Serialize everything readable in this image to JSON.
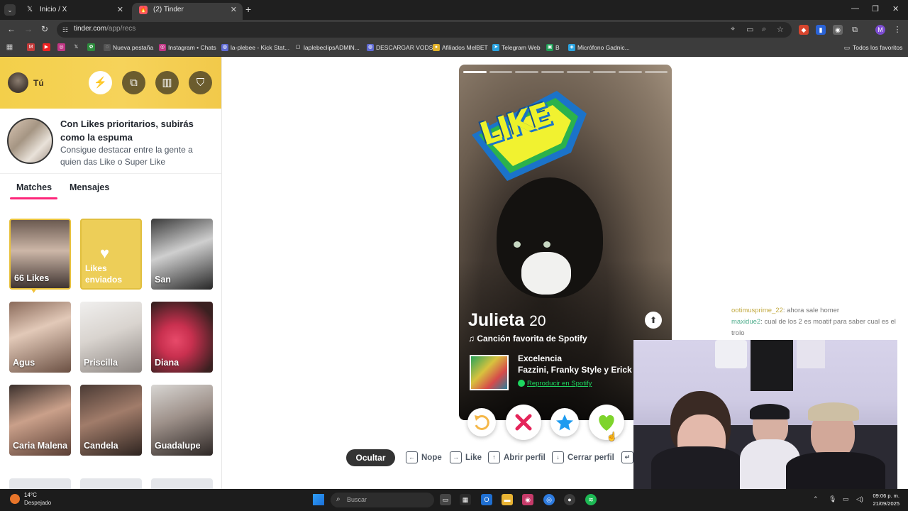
{
  "browser": {
    "tabs": [
      {
        "title": "Inicio / X",
        "icon": "x-logo"
      },
      {
        "title": "(2) Tinder",
        "icon": "tinder-logo"
      }
    ],
    "url_host": "tinder.com",
    "url_path": "/app/recs",
    "bookmarks": [
      "Nueva pestaña",
      "Instagram • Chats",
      "la-plebee - Kick Stat...",
      "laplebeclipsADMIN...",
      "DESCARGAR VODS",
      "Afiliados MelBET",
      "Telegram Web",
      "B",
      "Micrófono Gadnic..."
    ],
    "all_bookmarks": "Todos los favoritos",
    "profile_initial": "M"
  },
  "sidebar": {
    "me_label": "Tú",
    "header_buttons": [
      "boost-icon",
      "explore-icon",
      "briefcase-icon",
      "shield-icon"
    ],
    "promo_title": "Con Likes prioritarios, subirás como la espuma",
    "promo_sub": "Consigue destacar entre la gente a quien das Like o Super Like",
    "tabs": [
      "Matches",
      "Mensajes"
    ],
    "matches": [
      {
        "name": "66 Likes"
      },
      {
        "name": "Likes enviados"
      },
      {
        "name": "San"
      },
      {
        "name": "Agus"
      },
      {
        "name": "Priscilla"
      },
      {
        "name": "Diana"
      },
      {
        "name": "Caria Malena"
      },
      {
        "name": "Candela"
      },
      {
        "name": "Guadalupe"
      }
    ]
  },
  "card": {
    "sticker_text": "LIKE",
    "name": "Julieta",
    "age": "20",
    "spotify_header": "Canción favorita de Spotify",
    "song_title": "Excelencia",
    "song_artists": "Fazzini, Franky Style y Erick V",
    "play_label": "Reproducir en Spotify",
    "photo_count": 8,
    "active_photo": 0
  },
  "actions": [
    "rewind-icon",
    "nope-icon",
    "super-like-icon",
    "like-icon"
  ],
  "shortcuts": {
    "hide": "Ocultar",
    "nope": "Nope",
    "like": "Like",
    "open_profile": "Abrir perfil",
    "close_profile": "Cerrar perfil"
  },
  "chat": [
    {
      "user": "ootimusprime_22",
      "text": ": ahora sale homer"
    },
    {
      "user": "maxidue2",
      "text": ": cual de los 2 es moatif para saber cual es el trolo"
    }
  ],
  "taskbar": {
    "temp": "14°C",
    "weather": "Despejado",
    "search_placeholder": "Buscar",
    "time": "09:06 p. m.",
    "date": "21/09/2025"
  }
}
